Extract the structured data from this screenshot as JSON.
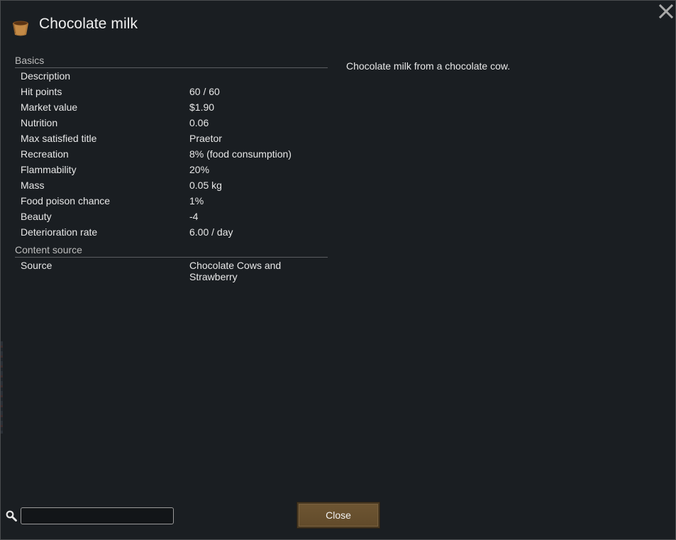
{
  "window": {
    "title": "Chocolate milk",
    "icon": "chocolate-milk-bucket-icon"
  },
  "sections": {
    "basics": {
      "header": "Basics",
      "rows": [
        {
          "label": "Description",
          "value": ""
        },
        {
          "label": "Hit points",
          "value": "60 / 60"
        },
        {
          "label": "Market value",
          "value": "$1.90"
        },
        {
          "label": "Nutrition",
          "value": "0.06"
        },
        {
          "label": "Max satisfied title",
          "value": "Praetor"
        },
        {
          "label": "Recreation",
          "value": "8% (food consumption)"
        },
        {
          "label": "Flammability",
          "value": "20%"
        },
        {
          "label": "Mass",
          "value": "0.05 kg"
        },
        {
          "label": "Food poison chance",
          "value": "1%"
        },
        {
          "label": "Beauty",
          "value": "-4"
        },
        {
          "label": "Deterioration rate",
          "value": "6.00 / day"
        }
      ]
    },
    "content_source": {
      "header": "Content source",
      "rows": [
        {
          "label": "Source",
          "value_line1": "Chocolate Cows and",
          "value_line2": "Strawberry"
        }
      ]
    }
  },
  "description_panel": {
    "text": "Chocolate milk from a chocolate cow."
  },
  "footer": {
    "search_value": "",
    "search_icon": "search-icon",
    "close_label": "Close"
  },
  "colors": {
    "background": "#1a1e22",
    "button": "#6e5633",
    "text": "#e8e8e8"
  }
}
